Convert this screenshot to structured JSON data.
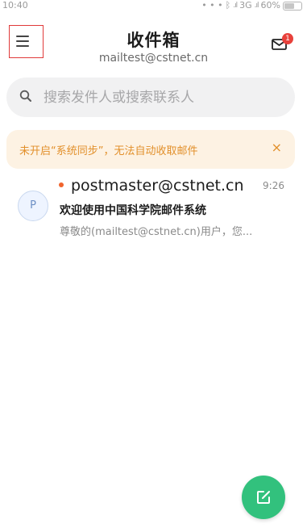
{
  "status_bar": {
    "time": "10:40",
    "network": "3G",
    "battery": "60%",
    "battery_level": 0.6
  },
  "header": {
    "title": "收件箱",
    "account": "mailtest@cstnet.cn",
    "menu_icon": "hamburger-menu-icon",
    "inbox_icon": "mail-tray-icon",
    "inbox_badge": "1"
  },
  "search": {
    "placeholder": "搜索发件人或搜索联系人",
    "icon": "search-icon"
  },
  "notice": {
    "text": "未开启“系统同步”，无法自动收取邮件",
    "close": "×"
  },
  "mails": [
    {
      "avatar_letter": "P",
      "sender": "postmaster@cstnet.cn",
      "time": "9:26",
      "subject": "欢迎使用中国科学院邮件系统",
      "preview": "尊敬的(mailtest@cstnet.cn)用户，您...",
      "unread": true
    }
  ],
  "compose": {
    "icon": "compose-icon"
  },
  "colors": {
    "accent": "#32c17d",
    "notice_bg": "#fdf2e3",
    "notice_text": "#e2902b",
    "badge": "#e8413b",
    "unread_dot": "#f0642d",
    "highlight_frame": "#e03a3a"
  }
}
